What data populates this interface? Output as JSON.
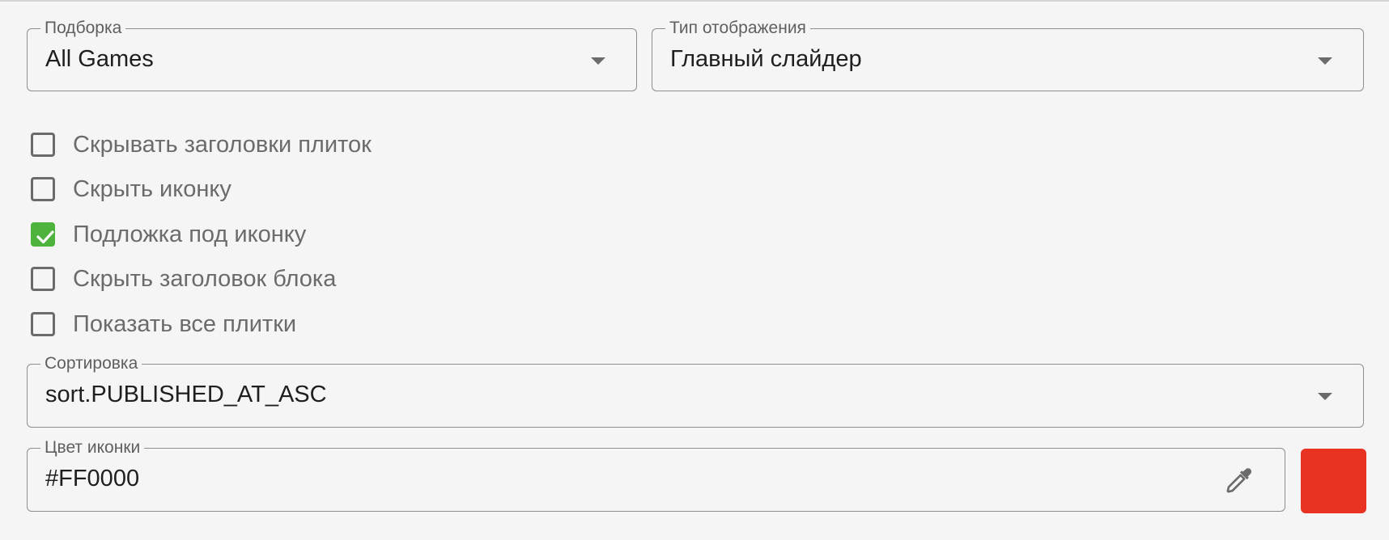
{
  "collection": {
    "label": "Подборка",
    "value": "All Games"
  },
  "display_type": {
    "label": "Тип отображения",
    "value": "Главный слайдер"
  },
  "checkboxes": [
    {
      "label": "Скрывать заголовки плиток",
      "checked": false
    },
    {
      "label": "Скрыть иконку",
      "checked": false
    },
    {
      "label": "Подложка под иконку",
      "checked": true
    },
    {
      "label": "Скрыть заголовок блока",
      "checked": false
    },
    {
      "label": "Показать все плитки",
      "checked": false
    }
  ],
  "sorting": {
    "label": "Сортировка",
    "value": "sort.PUBLISHED_AT_ASC"
  },
  "icon_color": {
    "label": "Цвет иконки",
    "value": "#FF0000",
    "swatch_color": "#e83323"
  },
  "colors": {
    "checkbox_checked": "#4db33d"
  },
  "icons": {
    "dropdown": "chevron-down-icon",
    "picker": "eyedropper-icon",
    "check": "checkmark-icon"
  }
}
